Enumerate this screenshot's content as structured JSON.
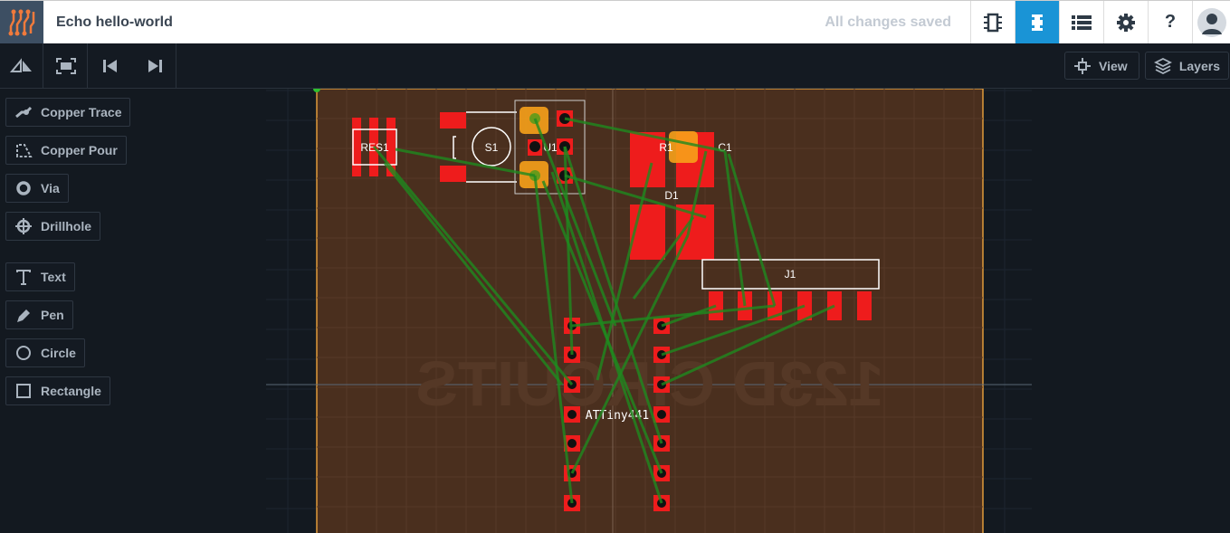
{
  "header": {
    "title": "Echo hello-world",
    "status": "All changes saved",
    "help": "?",
    "buttons": [
      {
        "icon": "schematic-chip-icon"
      },
      {
        "icon": "pcb-board-icon",
        "active": true
      },
      {
        "icon": "list-icon"
      },
      {
        "icon": "gear-icon"
      },
      {
        "icon": "help-icon"
      },
      {
        "icon": "avatar-icon"
      }
    ]
  },
  "toolbar": {
    "view_label": "View",
    "layers_label": "Layers"
  },
  "tools": [
    {
      "label": "Copper Trace",
      "icon": "copper-trace-icon"
    },
    {
      "label": "Copper Pour",
      "icon": "copper-pour-icon"
    },
    {
      "label": "Via",
      "icon": "via-icon"
    },
    {
      "label": "Drillhole",
      "icon": "drillhole-icon"
    },
    {
      "label": "Text",
      "icon": "text-icon"
    },
    {
      "label": "Pen",
      "icon": "pen-icon"
    },
    {
      "label": "Circle",
      "icon": "circle-icon"
    },
    {
      "label": "Rectangle",
      "icon": "rectangle-icon"
    }
  ],
  "board": {
    "watermark": "123D CIRCUITS",
    "labels": {
      "res1": "RES1",
      "s1": "S1",
      "u1": "U1",
      "r1": "R1",
      "c1": "C1",
      "d1": "D1",
      "j1": "J1",
      "attiny": "ATTiny441"
    },
    "colors": {
      "board": "#4a2f1e",
      "pad": "#ee1c1c",
      "trace": "#1f8a1f",
      "outline": "#e09a3a",
      "highlight": "#f7a11a"
    }
  }
}
